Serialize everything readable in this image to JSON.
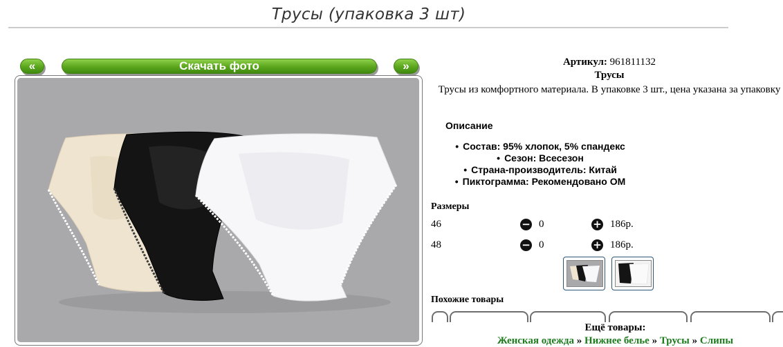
{
  "page": {
    "title": "Трусы (упаковка 3 шт)"
  },
  "gallery": {
    "prev_label": "«",
    "download_label": "Скачать фото",
    "next_label": "»"
  },
  "product": {
    "sku_label": "Артикул:",
    "sku_value": "961811132",
    "name": "Трусы",
    "description": "Трусы из комфортного материала. В упаковке 3 шт., цена указана за упаковку"
  },
  "specs": {
    "heading": "Описание",
    "items": [
      "Состав: 95% хлопок, 5% спандекс",
      "Сезон: Всесезон",
      "Страна-производитель: Китай",
      "Пиктограмма: Рекомендовано ОМ"
    ]
  },
  "sizes": {
    "heading": "Размеры",
    "rows": [
      {
        "size": "46",
        "qty": "0",
        "price": "186р."
      },
      {
        "size": "48",
        "qty": "0",
        "price": "186р."
      }
    ]
  },
  "similar": {
    "heading": "Похожие товары"
  },
  "more": {
    "label": "Ещё товары:",
    "crumbs": [
      "Женская одежда",
      "Нижнее белье",
      "Трусы",
      "Слипы"
    ],
    "separator": "»"
  },
  "colors": {
    "accent_green": "#5aa51c",
    "link_green": "#1e7b1e",
    "photo_bg": "#a9a8ab"
  }
}
